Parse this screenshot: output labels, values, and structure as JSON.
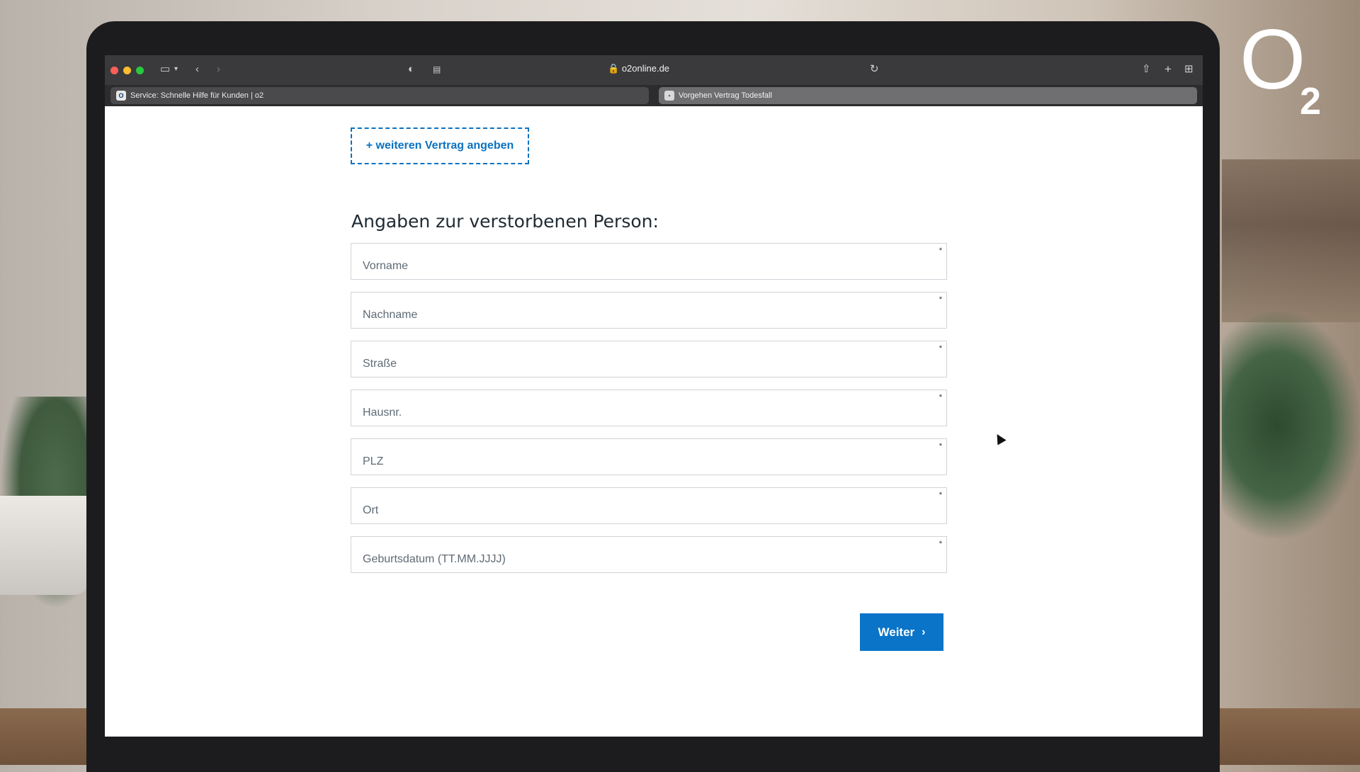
{
  "browser": {
    "url": "o2online.de",
    "tabs": [
      {
        "label": "Service: Schnelle Hilfe für Kunden | o2"
      },
      {
        "label": "Vorgehen Vertrag Todesfall"
      }
    ]
  },
  "page": {
    "add_contract_label": "+ weiteren Vertrag angeben",
    "section_title": "Angaben zur verstorbenen Person:",
    "fields": [
      {
        "placeholder": "Vorname",
        "required_mark": "*"
      },
      {
        "placeholder": "Nachname",
        "required_mark": "*"
      },
      {
        "placeholder": "Straße",
        "required_mark": "*"
      },
      {
        "placeholder": "Hausnr.",
        "required_mark": "*"
      },
      {
        "placeholder": "PLZ",
        "required_mark": "*"
      },
      {
        "placeholder": "Ort",
        "required_mark": "*"
      },
      {
        "placeholder": "Geburtsdatum (TT.MM.JJJJ)",
        "required_mark": "*"
      }
    ],
    "next_button_label": "Weiter",
    "next_button_icon": "chevron-right-icon"
  },
  "brand": {
    "logo_letter": "O",
    "logo_subscript": "2",
    "accent_color": "#0a74c8"
  }
}
